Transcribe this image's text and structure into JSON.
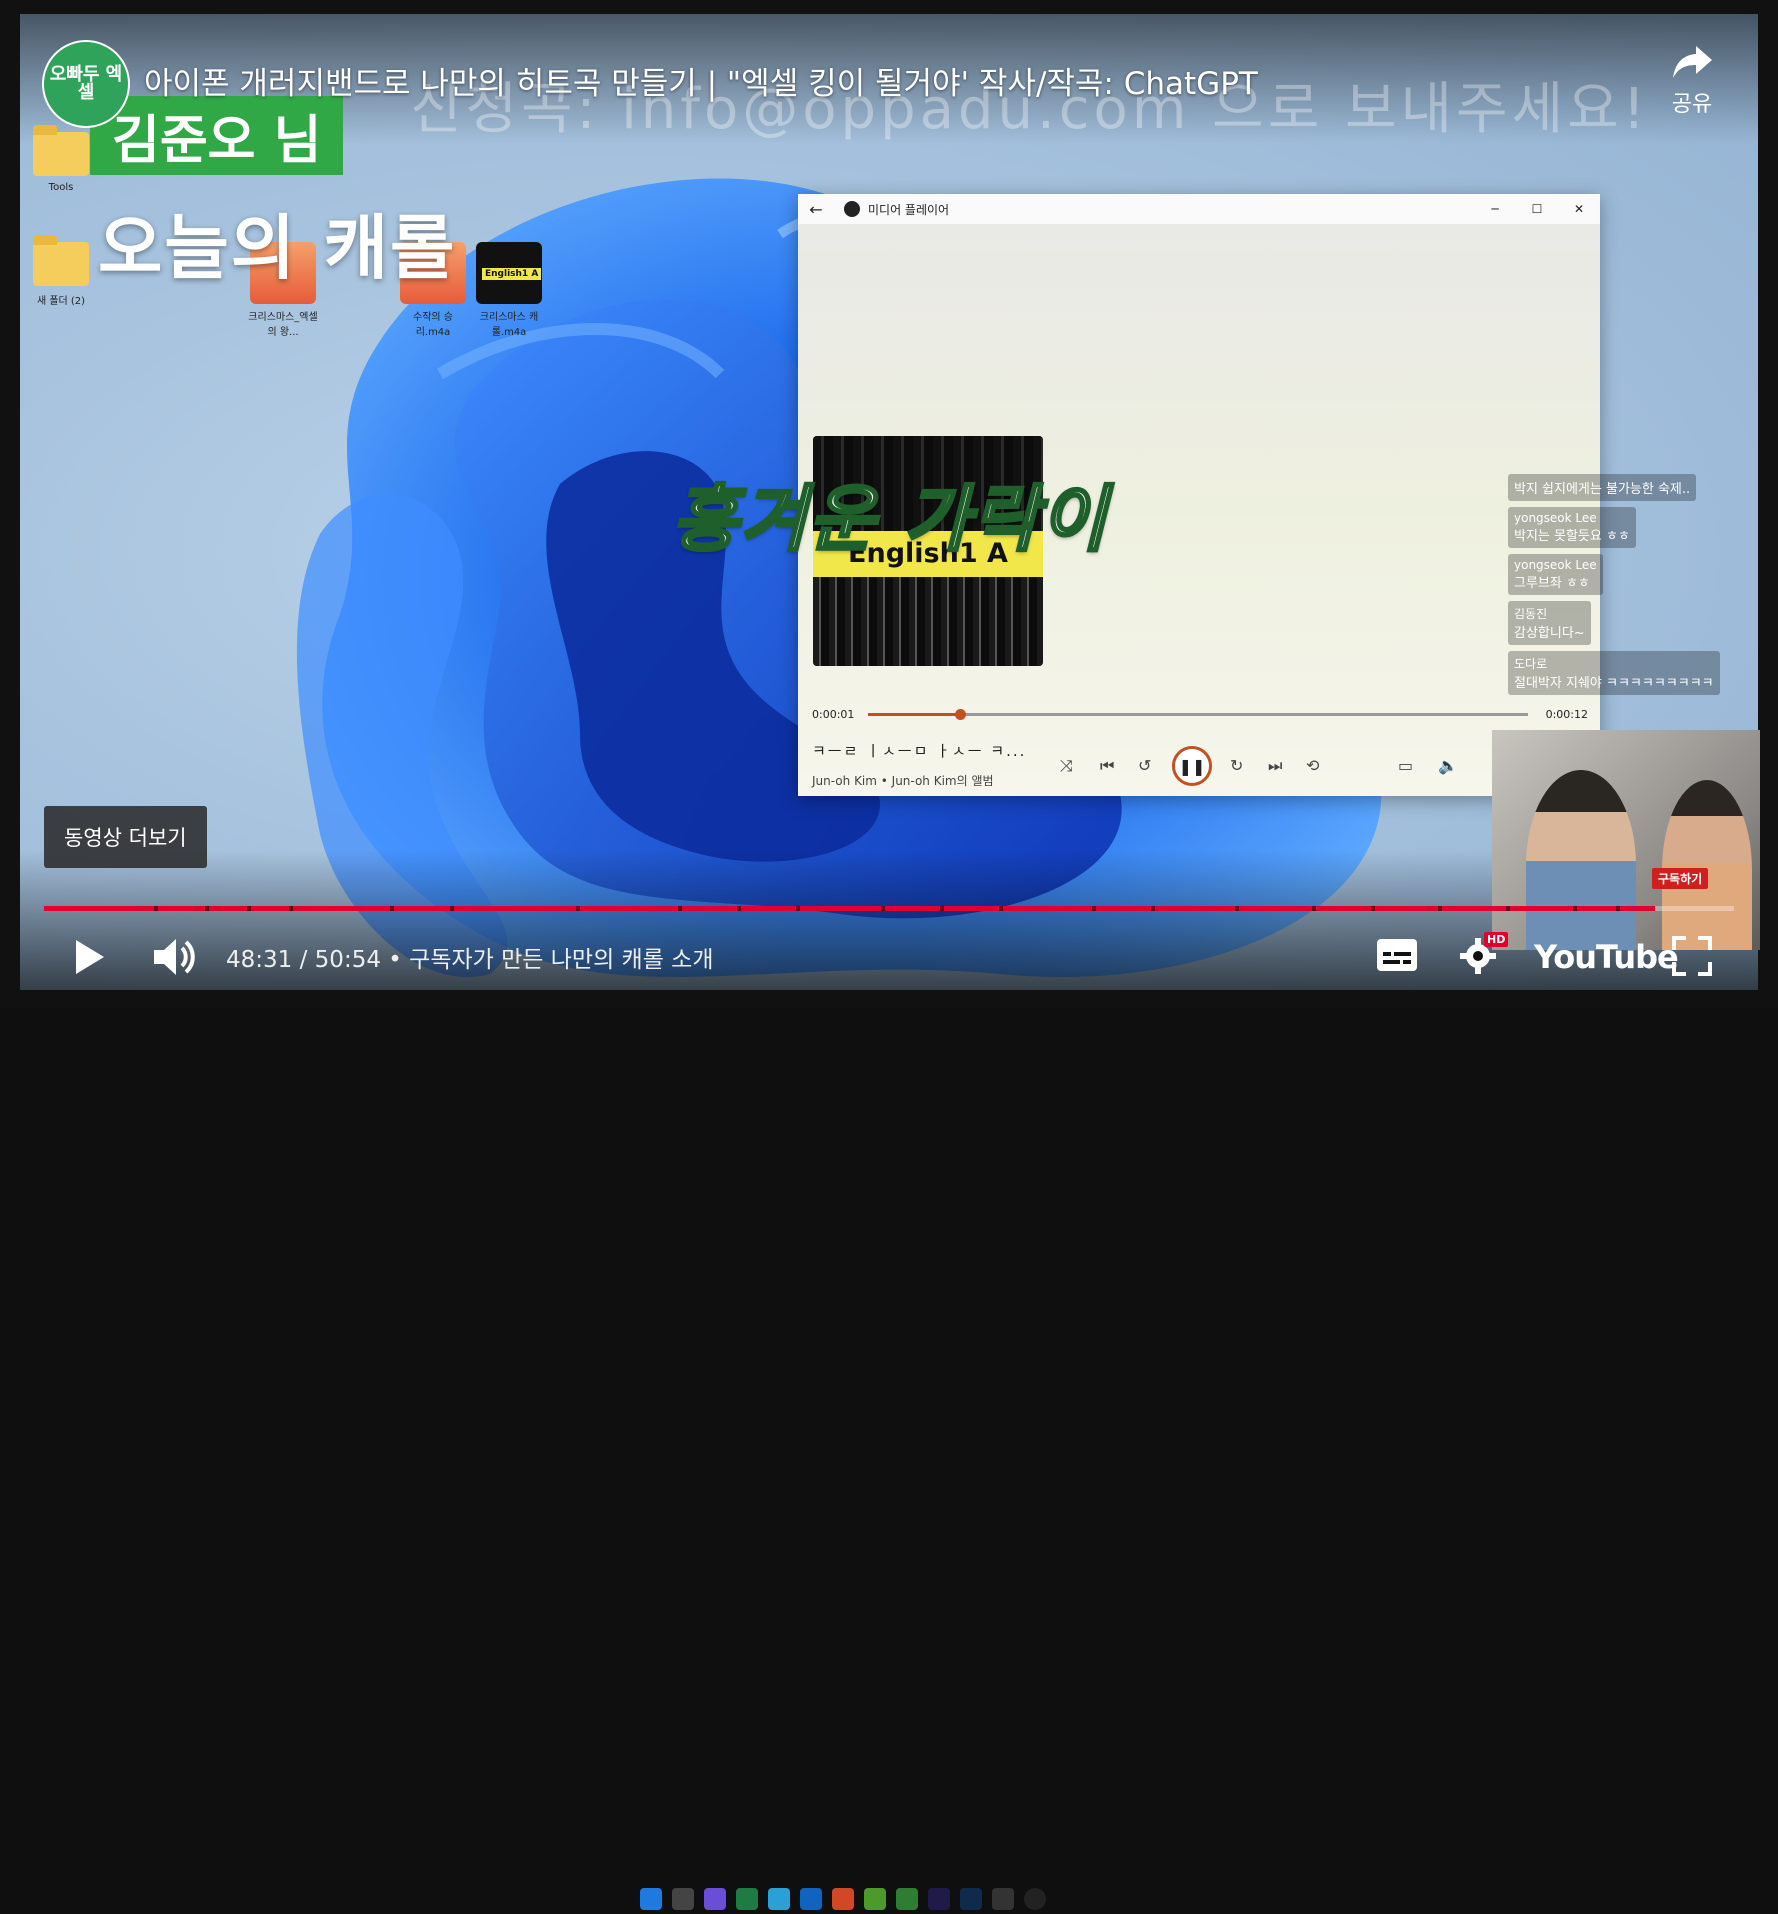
{
  "video": {
    "title": "아이폰 개러지밴드로 나만의 히트곡 만들기 | \"엑셀 킹이 될거야' 작사/작곡: ChatGPT",
    "channel_avatar_text": "오빠두 엑셀",
    "ghost_overlay_text": "신청곡: info@oppadu.com 으로 보내주세요!",
    "share_label": "공유",
    "name_tag": "김준오 님",
    "segment_heading": "오늘의 캐롤",
    "lyric_caption": "흥겨운 가락이",
    "more_videos_label": "동영상 더보기",
    "time_current": "48:31",
    "time_total": "50:54",
    "chapter": "구독자가 만든 나만의 캐롤 소개",
    "progress_fraction": 0.953,
    "youtube_logo": "YouTube",
    "hd_badge": "HD",
    "subscribe_badge": "구독하기"
  },
  "desktop": {
    "icons": [
      {
        "label": "Tools"
      },
      {
        "label": "새 폴더 (2)"
      },
      {
        "label": "크리스마스_엑셀의 왕..."
      },
      {
        "label": "수작의 승리.m4a"
      },
      {
        "label": "크리스마스 캐롤.m4a"
      }
    ]
  },
  "media_player": {
    "title": "미디어 플레이어",
    "album_text": "English1 A",
    "album_small_text": "English1 A",
    "time_elapsed": "0:00:01",
    "time_total": "0:00:12",
    "progress_fraction": 0.14,
    "song_title": "ㅋㅡㄹ ㅣㅅㅡㅁ ㅏㅅㅡ ㅋ...",
    "song_sub": "Jun-oh Kim • Jun-oh Kim의 앨범",
    "accent": "#c2511f"
  },
  "chat": {
    "messages": [
      {
        "who": "",
        "text": "박지 쉽지에게는 불가능한 숙제.."
      },
      {
        "who": "yongseok Lee",
        "text": "박지는 못할듯요 ㅎㅎ"
      },
      {
        "who": "yongseok Lee",
        "text": "그루브좌 ㅎㅎ"
      },
      {
        "who": "김동진",
        "text": "감상합니다~"
      },
      {
        "who": "도다로",
        "text": "절대박자 지쉐야 ㅋㅋㅋㅋㅋㅋㅋㅋㅋ"
      }
    ]
  },
  "colors": {
    "yt_red": "#e1002d",
    "name_tag_green": "#2fa845"
  }
}
